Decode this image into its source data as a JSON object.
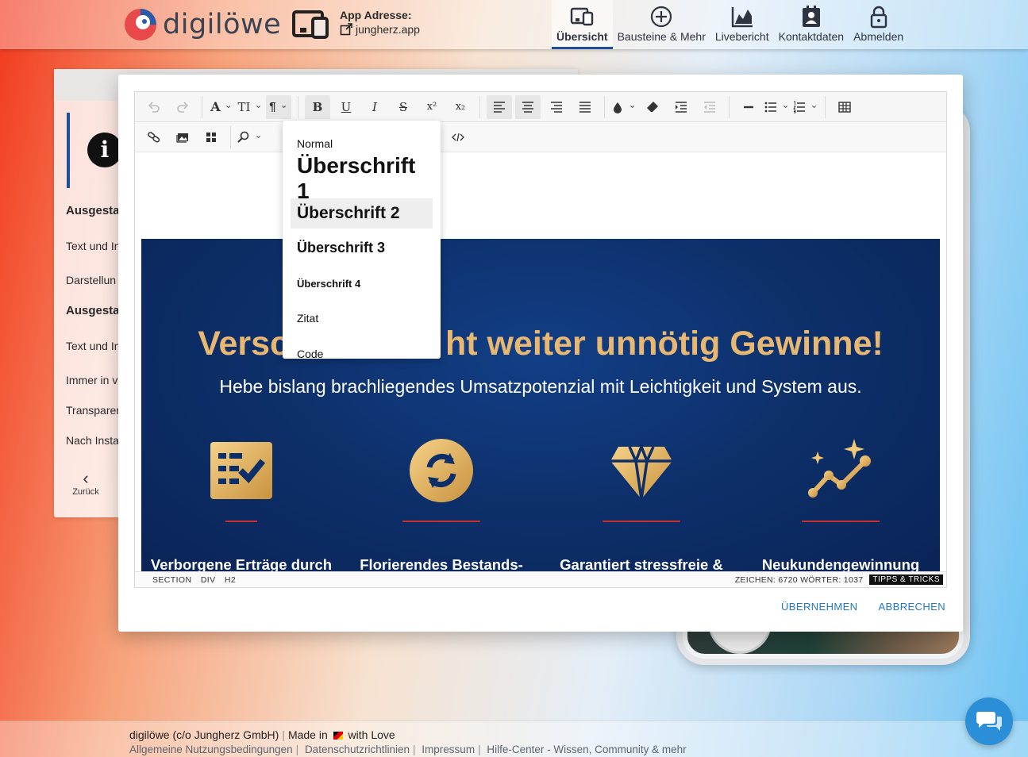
{
  "nav": {
    "logo_text": "digilöwe",
    "app_address_label": "App Adresse:",
    "app_address_url": "jungherz.app",
    "items": [
      {
        "label": "Übersicht",
        "icon": "devices-icon",
        "active": true
      },
      {
        "label": "Bausteine & Mehr",
        "icon": "plus-circle-icon",
        "active": false
      },
      {
        "label": "Livebericht",
        "icon": "chart-icon",
        "active": false
      },
      {
        "label": "Kontaktdaten",
        "icon": "contact-card-icon",
        "active": false
      },
      {
        "label": "Abmelden",
        "icon": "lock-icon",
        "active": false
      }
    ]
  },
  "sidebar": {
    "items": [
      {
        "label": "Ausgestal",
        "bold": true
      },
      {
        "label": "Text und In",
        "bold": false
      },
      {
        "label": "Darstellun",
        "bold": false
      },
      {
        "label": "Ausgestal",
        "bold": true
      },
      {
        "label": "Text und In",
        "bold": false
      },
      {
        "label": "Immer in v",
        "bold": false
      },
      {
        "label": "Transparen",
        "bold": false
      },
      {
        "label": "Nach Insta",
        "bold": false
      }
    ],
    "back_label": "Zurück"
  },
  "editor": {
    "format_menu": [
      "Normal",
      "Überschrift 1",
      "Überschrift 2",
      "Überschrift 3",
      "Überschrift 4",
      "Zitat",
      "Code"
    ],
    "format_menu_highlighted": "Überschrift 2",
    "hero": {
      "headline_left": "Versc",
      "headline_right": "ht weiter unnötig Gewinne!",
      "subheadline": "Hebe bislang brachliegendes Umsatzpotenzial mit Leichtigkeit und System aus.",
      "features": [
        {
          "title": "Verborgene Erträge durch optimale",
          "icon": "checklist-icon"
        },
        {
          "title": "Florierendes Bestands-kundengeschäft, das",
          "icon": "refresh-coin-icon"
        },
        {
          "title": "Garantiert stressfreie & kaufkräftige Kunden",
          "icon": "diamond-icon"
        },
        {
          "title": "Neukundengewinnung systematisieren, statt",
          "icon": "growth-stars-icon"
        }
      ]
    },
    "status_path": [
      "SECTION",
      "DIV",
      "H2"
    ],
    "status_counts": "ZEICHEN: 6720  WÖRTER: 1037",
    "tips_label": "TIPPS & TRICKS",
    "accent_gold": "#e8b872",
    "hero_blue": "#0d2f69"
  },
  "modal": {
    "apply_label": "ÜBERNEHMEN",
    "cancel_label": "ABBRECHEN"
  },
  "footer": {
    "line1_prefix": "digilöwe (c/o Jungherz GmbH)",
    "line1_made": "Made in",
    "line1_suffix": "with Love",
    "links": [
      "Allgemeine Nutzungsbedingungen",
      "Datenschutzrichtlinien",
      "Impressum",
      "Hilfe-Center - Wissen, Community & mehr"
    ]
  }
}
